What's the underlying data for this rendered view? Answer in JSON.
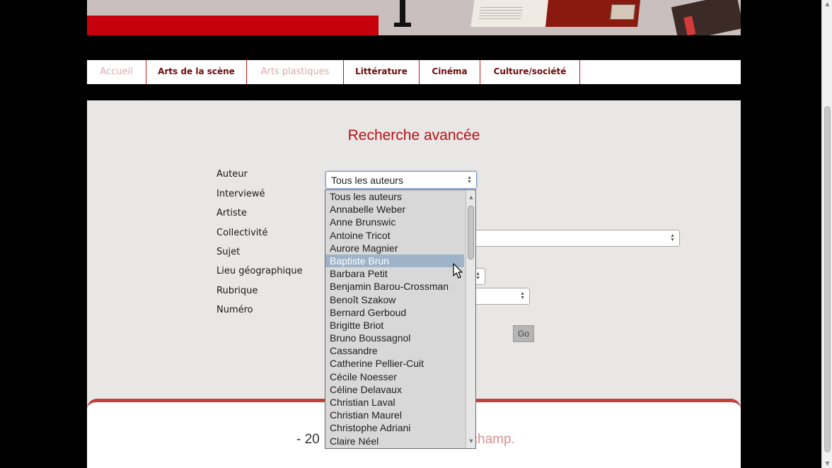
{
  "nav": {
    "tabs": [
      {
        "label": "Accueil",
        "active": false
      },
      {
        "label": "Arts de la scène",
        "active": true
      },
      {
        "label": "Arts plastiques",
        "active": false
      },
      {
        "label": "Littérature",
        "active": true
      },
      {
        "label": "Cinéma",
        "active": true
      },
      {
        "label": "Culture/société",
        "active": true
      }
    ]
  },
  "search": {
    "title": "Recherche avancée",
    "fields": [
      {
        "label": "Auteur"
      },
      {
        "label": "Interviewé"
      },
      {
        "label": "Artiste"
      },
      {
        "label": "Collectivité"
      },
      {
        "label": "Sujet"
      },
      {
        "label": "Lieu géographique"
      },
      {
        "label": "Rubrique"
      },
      {
        "label": "Numéro"
      }
    ],
    "auteur_selected": "Tous les auteurs",
    "go_label": "Go"
  },
  "dropdown": {
    "options": [
      "Tous les auteurs",
      "Annabelle Weber",
      "Anne Brunswic",
      "Antoine Tricot",
      "Aurore Magnier",
      "Baptiste Brun",
      "Barbara Petit",
      "Benjamin Barou-Crossman",
      "Benoît Szakow",
      "Bernard Gerboud",
      "Brigitte Briot",
      "Bruno Boussagnol",
      "Cassandre",
      "Catherine Pellier-Cuit",
      "Cécile Noesser",
      "Céline Delavaux",
      "Christian Laval",
      "Christian Maurel",
      "Christophe Adriani",
      "Claire Néel"
    ],
    "highlighted": "Baptiste Brun"
  },
  "footer": {
    "left_text": "- 20",
    "right_text": "schamp."
  },
  "colors": {
    "accent_red": "#c6000c",
    "title_red": "#b81313",
    "panel_bg": "#e9e6e6",
    "highlight": "#9fb3c8"
  }
}
